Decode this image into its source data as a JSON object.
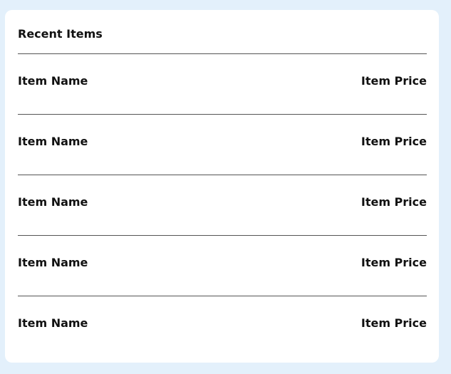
{
  "panel": {
    "title": "Recent Items"
  },
  "items": [
    {
      "name": "Item Name",
      "price": "Item Price"
    },
    {
      "name": "Item Name",
      "price": "Item Price"
    },
    {
      "name": "Item Name",
      "price": "Item Price"
    },
    {
      "name": "Item Name",
      "price": "Item Price"
    },
    {
      "name": "Item Name",
      "price": "Item Price"
    }
  ],
  "colors": {
    "page_background": "#e3f0fb",
    "card_background": "#ffffff",
    "divider": "#555555",
    "text": "#111111"
  }
}
